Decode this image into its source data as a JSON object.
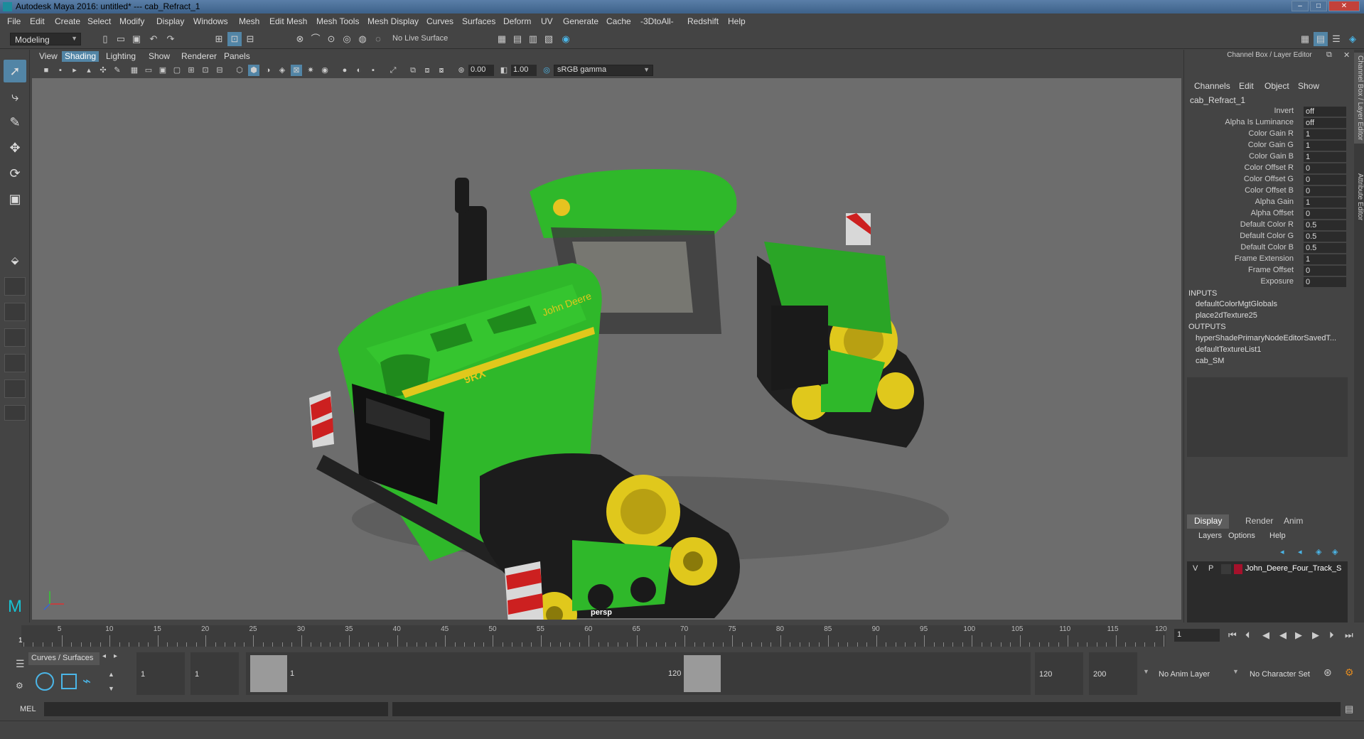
{
  "titlebar": {
    "title": "Autodesk Maya 2016: untitled*   ---   cab_Refract_1",
    "minimize": "–",
    "maximize": "□",
    "close": "✕"
  },
  "menubar": {
    "items": [
      "File",
      "Edit",
      "Create",
      "Select",
      "Modify",
      "Display",
      "Windows",
      "Mesh",
      "Edit Mesh",
      "Mesh Tools",
      "Mesh Display",
      "Curves",
      "Surfaces",
      "Deform",
      "UV",
      "Generate",
      "Cache",
      "-3DtoAll-",
      "Redshift",
      "Help"
    ]
  },
  "statusline": {
    "mode": "Modeling",
    "live_surface": "No Live Surface"
  },
  "viewport_menu": {
    "items": [
      "View",
      "Shading",
      "Lighting",
      "Show",
      "Renderer",
      "Panels"
    ],
    "active": "Shading"
  },
  "viewport_toolbar": {
    "exposure": "0.00",
    "gamma": "1.00",
    "color_space": "sRGB gamma"
  },
  "viewport": {
    "camera_label": "persp",
    "model_text": {
      "brand": "John Deere",
      "model": "9RX"
    }
  },
  "channel_box": {
    "header": "Channel Box / Layer Editor",
    "menu": [
      "Channels",
      "Edit",
      "Object",
      "Show"
    ],
    "node_name": "cab_Refract_1",
    "attributes": [
      {
        "label": "Invert",
        "value": "off"
      },
      {
        "label": "Alpha Is Luminance",
        "value": "off"
      },
      {
        "label": "Color Gain R",
        "value": "1"
      },
      {
        "label": "Color Gain G",
        "value": "1"
      },
      {
        "label": "Color Gain B",
        "value": "1"
      },
      {
        "label": "Color Offset R",
        "value": "0"
      },
      {
        "label": "Color Offset G",
        "value": "0"
      },
      {
        "label": "Color Offset B",
        "value": "0"
      },
      {
        "label": "Alpha Gain",
        "value": "1"
      },
      {
        "label": "Alpha Offset",
        "value": "0"
      },
      {
        "label": "Default Color R",
        "value": "0.5"
      },
      {
        "label": "Default Color G",
        "value": "0.5"
      },
      {
        "label": "Default Color B",
        "value": "0.5"
      },
      {
        "label": "Frame Extension",
        "value": "1"
      },
      {
        "label": "Frame Offset",
        "value": "0"
      },
      {
        "label": "Exposure",
        "value": "0"
      }
    ],
    "inputs_header": "INPUTS",
    "inputs": [
      "defaultColorMgtGlobals",
      "place2dTexture25"
    ],
    "outputs_header": "OUTPUTS",
    "outputs": [
      "hyperShadePrimaryNodeEditorSavedT...",
      "defaultTextureList1",
      "cab_SM"
    ]
  },
  "layer_editor": {
    "tabs": [
      "Display",
      "Render",
      "Anim"
    ],
    "active_tab": "Display",
    "menu": [
      "Layers",
      "Options",
      "Help"
    ],
    "layer": {
      "v": "V",
      "p": "P",
      "name": "John_Deere_Four_Track_S",
      "color": "#a5112b"
    }
  },
  "side_tabs": [
    "Channel Box / Layer Editor",
    "Attribute Editor"
  ],
  "timeline": {
    "ticks": [
      "5",
      "10",
      "15",
      "20",
      "25",
      "30",
      "35",
      "40",
      "45",
      "50",
      "55",
      "60",
      "65",
      "70",
      "75",
      "80",
      "85",
      "90",
      "95",
      "100",
      "105",
      "110",
      "115",
      "120"
    ],
    "start_marker": "1",
    "current_frame": "1"
  },
  "range": {
    "shelf_tab": "Curves / Surfaces",
    "start_time": "1",
    "playback_start": "1",
    "range_start_label": "1",
    "range_end_label": "120",
    "playback_end": "120",
    "end_time": "200",
    "anim_layer": "No Anim Layer",
    "character_set": "No Character Set"
  },
  "commandline": {
    "lang": "MEL"
  },
  "colors": {
    "accent": "#5285a6",
    "tractor_green": "#2fb82a",
    "tractor_yellow": "#e8d020",
    "layer_color": "#a5112b"
  }
}
